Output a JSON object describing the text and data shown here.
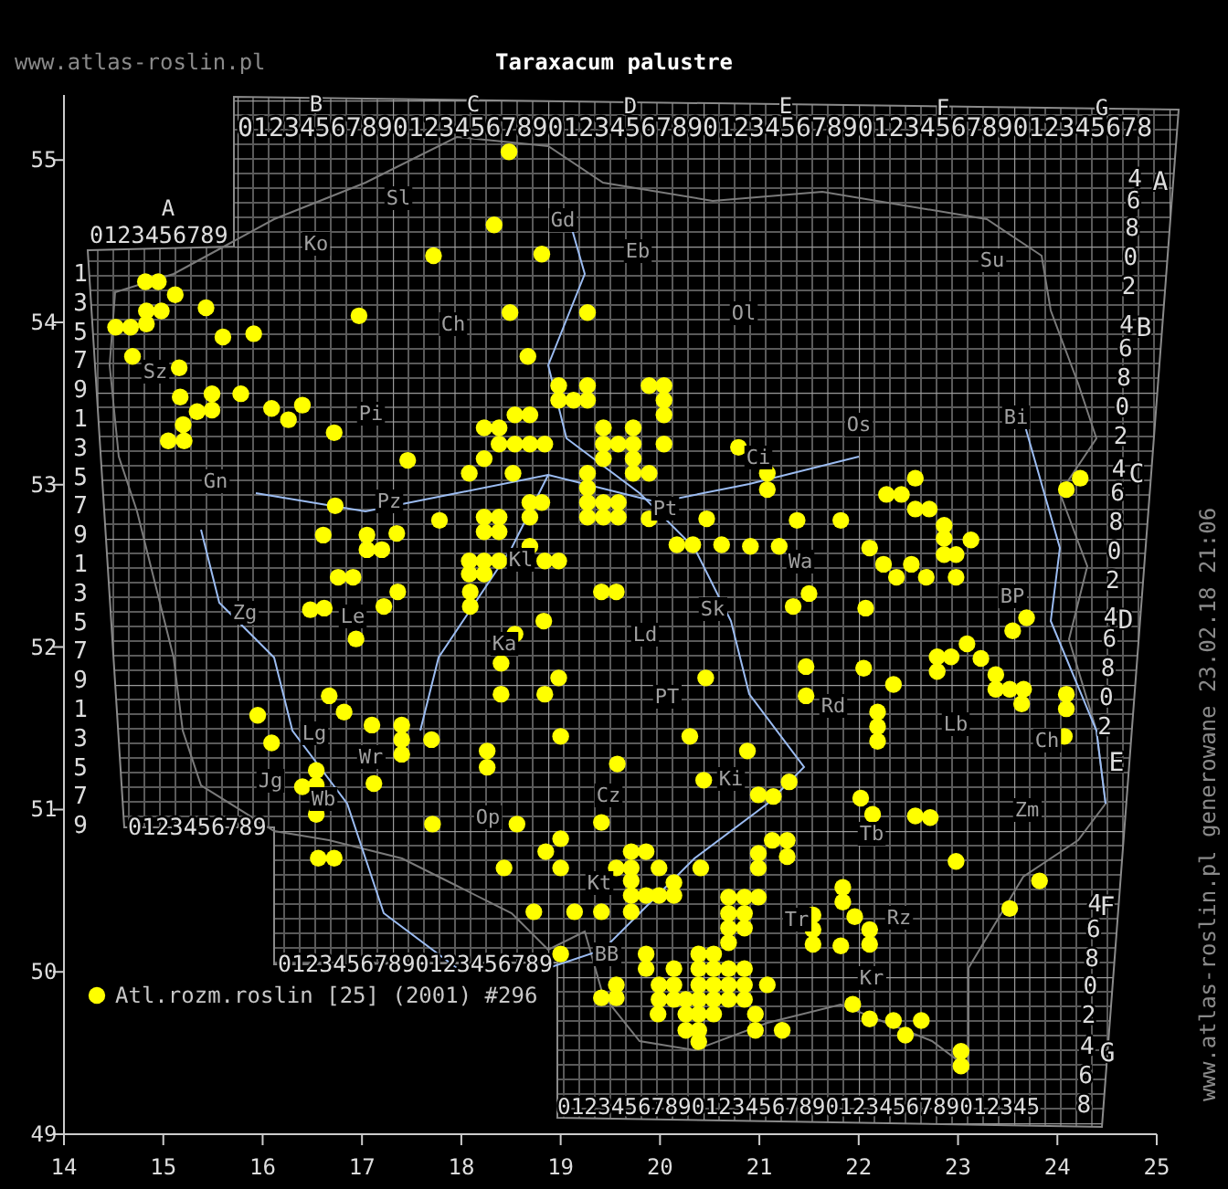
{
  "header": {
    "site": "www.atlas-roslin.pl",
    "title": "Taraxacum palustre"
  },
  "map": {
    "column_letters": [
      "A",
      "B",
      "C",
      "D",
      "E",
      "F",
      "G"
    ],
    "row_letters": [
      "A",
      "B",
      "C",
      "D",
      "E",
      "F",
      "G"
    ],
    "digit_rows": [
      "0123456789",
      "01234567890123456789012345678901234567890123456789012345678",
      "0123456789",
      "01234567890123456789",
      "012345678901234567890123456789012345"
    ],
    "left_row_labels": [
      "1",
      "3",
      "5",
      "7",
      "9",
      "1",
      "3",
      "5",
      "7",
      "9",
      "1",
      "3",
      "5",
      "7",
      "9",
      "1",
      "3",
      "5",
      "7",
      "9"
    ],
    "right_row_labels": [
      "4",
      "6",
      "8",
      "0",
      "2",
      "4",
      "6",
      "8",
      "0",
      "2",
      "4",
      "6",
      "8",
      "0",
      "2",
      "4",
      "6",
      "8",
      "0",
      "2",
      "4",
      "6",
      "8",
      "0",
      "2",
      "4",
      "6",
      "8"
    ],
    "region_labels": [
      "Sl",
      "Ko",
      "Gd",
      "Eb",
      "Ol",
      "Su",
      "Ch",
      "Pi",
      "Sz",
      "Gn",
      "Pz",
      "Kl",
      "Bi",
      "Ci",
      "Os",
      "Pt",
      "Wa",
      "Sk",
      "Ld",
      "PT",
      "Rd",
      "Lb",
      "BP",
      "Ch",
      "Ki",
      "Zm",
      "Tb",
      "Tr",
      "Rz",
      "Kr",
      "Zg",
      "Le",
      "Ka",
      "Lg",
      "Wr",
      "Jg",
      "Wb",
      "Op",
      "Cz",
      "Kt",
      "BB"
    ],
    "chart_data": {
      "type": "scatter",
      "xlim": [
        14,
        25
      ],
      "ylim": [
        49,
        55.4
      ],
      "xticks": [
        14,
        15,
        16,
        17,
        18,
        19,
        20,
        21,
        22,
        23,
        24,
        25
      ],
      "yticks": [
        49,
        50,
        51,
        52,
        53,
        54,
        55
      ],
      "x": [
        14.82,
        14.95,
        15.12,
        15.43,
        14.83,
        14.98,
        14.52,
        14.67,
        14.83,
        15.6,
        15.91,
        14.69,
        15.16,
        16.97,
        17.72,
        18.33,
        18.81,
        18.49,
        19.27,
        18.67,
        18.48,
        15.17,
        15.49,
        15.78,
        15.34,
        15.49,
        16.09,
        16.4,
        16.26,
        15.2,
        15.05,
        15.21,
        16.72,
        17.46,
        18.08,
        18.23,
        18.52,
        18.23,
        18.38,
        18.38,
        18.54,
        18.69,
        18.84,
        18.69,
        18.54,
        18.98,
        19.13,
        18.98,
        19.27,
        19.27,
        19.43,
        19.43,
        19.43,
        19.58,
        19.73,
        19.73,
        19.73,
        19.73,
        19.27,
        19.27,
        19.27,
        19.27,
        19.43,
        19.43,
        19.58,
        19.58,
        18.81,
        18.69,
        18.69,
        18.23,
        18.38,
        18.23,
        18.38,
        18.69,
        17.78,
        16.73,
        16.61,
        17.05,
        17.05,
        17.2,
        17.35,
        18.08,
        18.23,
        18.38,
        18.84,
        18.98,
        18.08,
        18.23,
        16.76,
        16.91,
        19.89,
        20.04,
        20.04,
        20.04,
        19.89,
        20.04,
        20.79,
        21.08,
        21.08,
        21.38,
        21.82,
        20.47,
        19.89,
        20.17,
        20.33,
        20.62,
        20.91,
        21.2,
        22.11,
        22.25,
        22.53,
        22.38,
        22.68,
        22.98,
        22.57,
        22.28,
        22.43,
        22.57,
        22.71,
        22.86,
        22.86,
        22.86,
        22.98,
        23.13,
        24.09,
        24.23,
        16.48,
        16.62,
        17.22,
        17.36,
        18.09,
        18.09,
        19.41,
        19.56,
        16.94,
        18.83,
        18.54,
        18.4,
        18.4,
        18.84,
        18.98,
        16.67,
        16.82,
        15.95,
        16.09,
        17.1,
        17.4,
        17.4,
        17.4,
        17.7,
        18.26,
        18.26,
        19.0,
        19.57,
        16.54,
        16.54,
        16.4,
        17.12,
        16.54,
        17.71,
        18.56,
        19.0,
        18.85,
        19.0,
        18.43,
        19.41,
        16.56,
        16.72,
        18.73,
        19.14,
        19.41,
        19.0,
        19.41,
        19.56,
        19.56,
        19.56,
        19.71,
        19.71,
        19.71,
        19.71,
        19.71,
        21.5,
        21.34,
        22.07,
        23.55,
        23.69,
        23.09,
        22.79,
        22.93,
        22.79,
        23.23,
        23.38,
        23.38,
        23.52,
        23.66,
        23.64,
        24.09,
        24.09,
        24.07,
        21.47,
        22.05,
        22.35,
        20.46,
        21.47,
        22.19,
        22.19,
        22.19,
        20.3,
        20.88,
        20.44,
        20.99,
        21.14,
        21.3,
        22.02,
        22.14,
        22.57,
        22.72,
        22.98,
        23.82,
        23.52,
        19.86,
        19.99,
        19.86,
        19.99,
        20.14,
        20.14,
        20.41,
        20.99,
        20.99,
        21.13,
        21.28,
        21.28,
        20.69,
        20.85,
        20.99,
        20.69,
        20.85,
        20.69,
        20.85,
        20.69,
        21.54,
        21.54,
        21.54,
        21.84,
        21.84,
        21.96,
        22.11,
        22.11,
        21.82,
        19.86,
        19.86,
        19.99,
        20.14,
        20.14,
        19.99,
        20.14,
        20.39,
        20.54,
        20.39,
        20.54,
        20.69,
        20.85,
        20.39,
        20.54,
        20.69,
        20.85,
        20.26,
        20.39,
        20.54,
        20.69,
        20.85,
        20.26,
        20.39,
        20.54,
        20.26,
        20.39,
        20.39,
        20.96,
        20.96,
        21.08,
        21.23,
        21.94,
        22.11,
        22.35,
        22.47,
        22.63,
        23.03,
        23.03,
        19.98
      ],
      "series": [
        {
          "name": "Atl.rozm.roslin [25] (2001) #296",
          "color": "#ffff00",
          "values": [
            54.25,
            54.25,
            54.17,
            54.09,
            54.07,
            54.07,
            53.97,
            53.97,
            53.99,
            53.91,
            53.93,
            53.79,
            53.72,
            54.04,
            54.41,
            54.6,
            54.42,
            54.06,
            54.06,
            53.79,
            55.05,
            53.54,
            53.56,
            53.56,
            53.45,
            53.46,
            53.47,
            53.49,
            53.4,
            53.37,
            53.27,
            53.27,
            53.32,
            53.15,
            53.07,
            53.16,
            53.07,
            53.35,
            53.35,
            53.25,
            53.25,
            53.25,
            53.25,
            53.43,
            53.43,
            53.61,
            53.52,
            53.52,
            53.61,
            53.52,
            53.35,
            53.25,
            53.16,
            53.25,
            53.35,
            53.25,
            53.16,
            53.07,
            53.07,
            52.98,
            52.89,
            52.8,
            52.89,
            52.8,
            52.89,
            52.8,
            52.89,
            52.89,
            52.8,
            52.8,
            52.8,
            52.71,
            52.71,
            52.62,
            52.78,
            52.87,
            52.69,
            52.69,
            52.6,
            52.6,
            52.7,
            52.53,
            52.53,
            52.53,
            52.53,
            52.53,
            52.45,
            52.45,
            52.43,
            52.43,
            53.61,
            53.61,
            53.52,
            53.43,
            53.07,
            53.25,
            53.23,
            53.07,
            52.97,
            52.78,
            52.78,
            52.79,
            52.79,
            52.63,
            52.63,
            52.63,
            52.62,
            52.62,
            52.61,
            52.51,
            52.51,
            52.43,
            52.43,
            52.43,
            53.04,
            52.94,
            52.94,
            52.85,
            52.85,
            52.75,
            52.67,
            52.57,
            52.57,
            52.66,
            52.97,
            53.04,
            52.23,
            52.24,
            52.25,
            52.34,
            52.34,
            52.25,
            52.34,
            52.34,
            52.05,
            52.16,
            52.08,
            51.9,
            51.71,
            51.71,
            51.81,
            51.7,
            51.6,
            51.58,
            51.41,
            51.52,
            51.52,
            51.43,
            51.34,
            51.43,
            51.36,
            51.26,
            51.45,
            51.28,
            51.24,
            51.15,
            51.14,
            51.16,
            50.97,
            50.91,
            50.91,
            50.82,
            50.74,
            50.64,
            50.64,
            50.92,
            50.7,
            50.7,
            50.37,
            50.37,
            50.37,
            50.11,
            49.84,
            49.84,
            49.92,
            50.64,
            50.74,
            50.64,
            50.56,
            50.47,
            50.37,
            52.33,
            52.25,
            52.24,
            52.1,
            52.18,
            52.02,
            51.94,
            51.94,
            51.85,
            51.93,
            51.83,
            51.74,
            51.74,
            51.74,
            51.65,
            51.71,
            51.62,
            51.45,
            51.88,
            51.87,
            51.77,
            51.81,
            51.7,
            51.6,
            51.51,
            51.42,
            51.45,
            51.36,
            51.18,
            51.09,
            51.08,
            51.17,
            51.07,
            50.97,
            50.96,
            50.95,
            50.68,
            50.56,
            50.39,
            50.74,
            50.64,
            50.47,
            50.47,
            50.47,
            50.55,
            50.64,
            50.73,
            50.64,
            50.81,
            50.81,
            50.71,
            50.46,
            50.46,
            50.46,
            50.36,
            50.36,
            50.27,
            50.27,
            50.18,
            50.35,
            50.26,
            50.17,
            50.52,
            50.43,
            50.34,
            50.26,
            50.17,
            50.16,
            50.11,
            50.02,
            49.92,
            50.02,
            49.92,
            49.83,
            49.83,
            50.11,
            50.11,
            50.02,
            50.02,
            50.02,
            50.02,
            49.92,
            49.92,
            49.92,
            49.92,
            49.83,
            49.83,
            49.83,
            49.83,
            49.83,
            49.74,
            49.74,
            49.74,
            49.64,
            49.64,
            49.57,
            49.74,
            49.64,
            49.92,
            49.64,
            49.8,
            49.71,
            49.7,
            49.61,
            49.7,
            49.51,
            49.42,
            49.74
          ]
        }
      ]
    }
  },
  "stamp": "www.atlas-roslin.pl generowane 23.02.18 21:06"
}
